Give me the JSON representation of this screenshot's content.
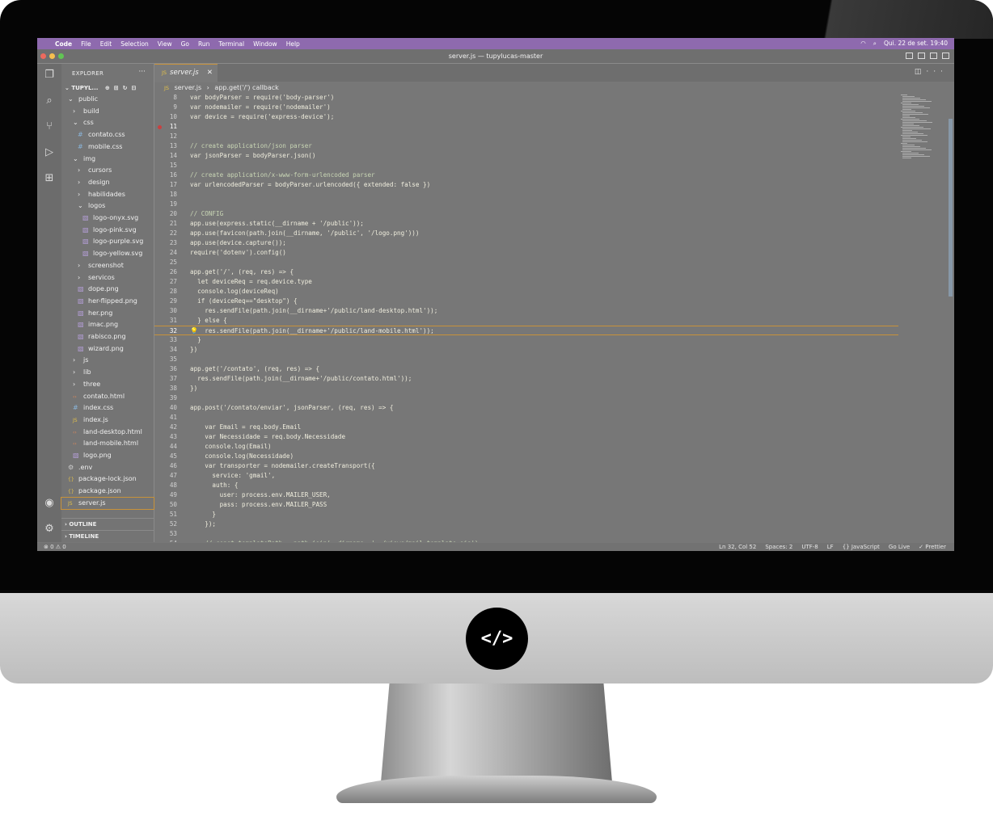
{
  "menubar": {
    "app": "Code",
    "items": [
      "File",
      "Edit",
      "Selection",
      "View",
      "Go",
      "Run",
      "Terminal",
      "Window",
      "Help"
    ],
    "clock": "Qui. 22 de set.  19:40"
  },
  "window": {
    "title": "server.js — tupylucas-master"
  },
  "sidebar": {
    "header": "EXPLORER",
    "project": "TUPYL...",
    "outline": "OUTLINE",
    "timeline": "TIMELINE",
    "tree": [
      {
        "label": "public",
        "kind": "folder-open"
      },
      {
        "label": "build",
        "kind": "folder"
      },
      {
        "label": "css",
        "kind": "folder-open"
      },
      {
        "label": "contato.css",
        "kind": "css"
      },
      {
        "label": "mobile.css",
        "kind": "css"
      },
      {
        "label": "img",
        "kind": "folder-open"
      },
      {
        "label": "cursors",
        "kind": "folder"
      },
      {
        "label": "design",
        "kind": "folder"
      },
      {
        "label": "habilidades",
        "kind": "folder"
      },
      {
        "label": "logos",
        "kind": "folder-open"
      },
      {
        "label": "logo-onyx.svg",
        "kind": "img"
      },
      {
        "label": "logo-pink.svg",
        "kind": "img"
      },
      {
        "label": "logo-purple.svg",
        "kind": "img"
      },
      {
        "label": "logo-yellow.svg",
        "kind": "img"
      },
      {
        "label": "screenshot",
        "kind": "folder"
      },
      {
        "label": "servicos",
        "kind": "folder"
      },
      {
        "label": "dope.png",
        "kind": "img"
      },
      {
        "label": "her-flipped.png",
        "kind": "img"
      },
      {
        "label": "her.png",
        "kind": "img"
      },
      {
        "label": "imac.png",
        "kind": "img"
      },
      {
        "label": "rabisco.png",
        "kind": "img"
      },
      {
        "label": "wizard.png",
        "kind": "img"
      },
      {
        "label": "js",
        "kind": "folder"
      },
      {
        "label": "lib",
        "kind": "folder"
      },
      {
        "label": "three",
        "kind": "folder"
      },
      {
        "label": "contato.html",
        "kind": "html"
      },
      {
        "label": "index.css",
        "kind": "css"
      },
      {
        "label": "index.js",
        "kind": "js"
      },
      {
        "label": "land-desktop.html",
        "kind": "html"
      },
      {
        "label": "land-mobile.html",
        "kind": "html"
      },
      {
        "label": "logo.png",
        "kind": "img"
      },
      {
        "label": ".env",
        "kind": "gear"
      },
      {
        "label": "package-lock.json",
        "kind": "json"
      },
      {
        "label": "package.json",
        "kind": "json"
      },
      {
        "label": "server.js",
        "kind": "js"
      }
    ]
  },
  "editor": {
    "tab": "server.js",
    "tab_badge": "JS",
    "breadcrumb": [
      "server.js",
      "app.get('/') callback"
    ],
    "lines": [
      {
        "n": "8",
        "text": "var bodyParser = require('body-parser')"
      },
      {
        "n": "9",
        "text": "var nodemailer = require('nodemailer')"
      },
      {
        "n": "10",
        "text": "var device = require('express-device');"
      },
      {
        "n": "11",
        "text": ""
      },
      {
        "n": "12",
        "text": ""
      },
      {
        "n": "13",
        "text": "// create application/json parser"
      },
      {
        "n": "14",
        "text": "var jsonParser = bodyParser.json()"
      },
      {
        "n": "15",
        "text": ""
      },
      {
        "n": "16",
        "text": "// create application/x-www-form-urlencoded parser"
      },
      {
        "n": "17",
        "text": "var urlencodedParser = bodyParser.urlencoded({ extended: false })"
      },
      {
        "n": "18",
        "text": ""
      },
      {
        "n": "19",
        "text": ""
      },
      {
        "n": "20",
        "text": "// CONFIG"
      },
      {
        "n": "21",
        "text": "app.use(express.static(__dirname + '/public'));"
      },
      {
        "n": "22",
        "text": "app.use(favicon(path.join(__dirname, '/public', '/logo.png')))"
      },
      {
        "n": "23",
        "text": "app.use(device.capture());"
      },
      {
        "n": "24",
        "text": "require('dotenv').config()"
      },
      {
        "n": "25",
        "text": ""
      },
      {
        "n": "26",
        "text": "app.get('/', (req, res) => {"
      },
      {
        "n": "27",
        "text": "  let deviceReq = req.device.type"
      },
      {
        "n": "28",
        "text": "  console.log(deviceReq)"
      },
      {
        "n": "29",
        "text": "  if (deviceReq==\"desktop\") {"
      },
      {
        "n": "30",
        "text": "    res.sendFile(path.join(__dirname+'/public/land-desktop.html'));"
      },
      {
        "n": "31",
        "text": "  } else {"
      },
      {
        "n": "32",
        "text": "    res.sendFile(path.join(__dirname+'/public/land-mobile.html'));"
      },
      {
        "n": "33",
        "text": "  }"
      },
      {
        "n": "34",
        "text": "})"
      },
      {
        "n": "35",
        "text": ""
      },
      {
        "n": "36",
        "text": "app.get('/contato', (req, res) => {"
      },
      {
        "n": "37",
        "text": "  res.sendFile(path.join(__dirname+'/public/contato.html'));"
      },
      {
        "n": "38",
        "text": "})"
      },
      {
        "n": "39",
        "text": ""
      },
      {
        "n": "40",
        "text": "app.post('/contato/enviar', jsonParser, (req, res) => {"
      },
      {
        "n": "41",
        "text": ""
      },
      {
        "n": "42",
        "text": "    var Email = req.body.Email"
      },
      {
        "n": "43",
        "text": "    var Necessidade = req.body.Necessidade"
      },
      {
        "n": "44",
        "text": "    console.log(Email)"
      },
      {
        "n": "45",
        "text": "    console.log(Necessidade)"
      },
      {
        "n": "46",
        "text": "    var transporter = nodemailer.createTransport({"
      },
      {
        "n": "47",
        "text": "      service: 'gmail',"
      },
      {
        "n": "48",
        "text": "      auth: {"
      },
      {
        "n": "49",
        "text": "        user: process.env.MAILER_USER,"
      },
      {
        "n": "50",
        "text": "        pass: process.env.MAILER_PASS"
      },
      {
        "n": "51",
        "text": "      }"
      },
      {
        "n": "52",
        "text": "    });"
      },
      {
        "n": "53",
        "text": ""
      },
      {
        "n": "54",
        "text": "    // const templatePath = path.join(__dirname, '../views/mail-template.ejs')"
      }
    ],
    "active_line": "32",
    "breakpoint_line": "11"
  },
  "statusbar": {
    "problems": "⊗ 0 ⚠ 0",
    "position": "Ln 32, Col 52",
    "spaces": "Spaces: 2",
    "encoding": "UTF-8",
    "eol": "LF",
    "language": "{} JavaScript",
    "golive": "Go Live",
    "prettier": "✓ Prettier"
  },
  "colors": {
    "menubar_bg": "#8e6aae",
    "accent": "#c8923a",
    "traffic_red": "#ed6a5e",
    "traffic_yellow": "#f5bf4f",
    "traffic_green": "#61c554"
  },
  "brand": {
    "monitor_logo": "</>"
  }
}
